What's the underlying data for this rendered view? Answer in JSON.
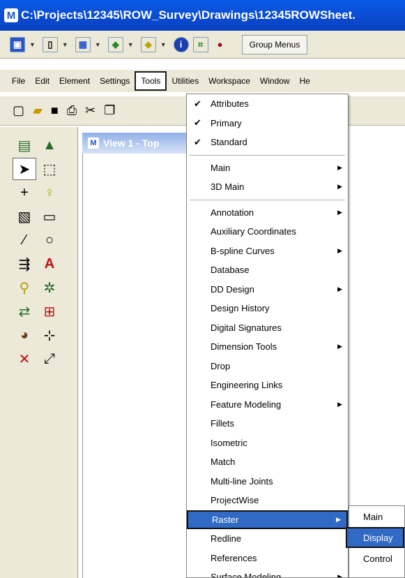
{
  "window": {
    "title": "C:\\Projects\\12345\\ROW_Survey\\Drawings\\12345ROWSheet."
  },
  "toolbar1": {
    "group_menus_label": "Group Menus"
  },
  "menubar": {
    "items": [
      {
        "label": "File"
      },
      {
        "label": "Edit"
      },
      {
        "label": "Element"
      },
      {
        "label": "Settings"
      },
      {
        "label": "Tools"
      },
      {
        "label": "Utilities"
      },
      {
        "label": "Workspace"
      },
      {
        "label": "Window"
      },
      {
        "label": "He"
      }
    ]
  },
  "view": {
    "title": "View 1 - Top"
  },
  "tools_menu": {
    "checked": [
      {
        "label": "Attributes"
      },
      {
        "label": "Primary"
      },
      {
        "label": "Standard"
      }
    ],
    "group2": [
      {
        "label": "Main"
      },
      {
        "label": "3D Main"
      }
    ],
    "group3": [
      {
        "label": "Annotation"
      },
      {
        "label": "Auxiliary Coordinates"
      },
      {
        "label": "B-spline Curves"
      },
      {
        "label": "Database"
      },
      {
        "label": "DD Design"
      },
      {
        "label": "Design History"
      },
      {
        "label": "Digital Signatures"
      },
      {
        "label": "Dimension Tools"
      },
      {
        "label": "Drop"
      },
      {
        "label": "Engineering Links"
      },
      {
        "label": "Feature Modeling"
      },
      {
        "label": "Fillets"
      },
      {
        "label": "Isometric"
      },
      {
        "label": "Match"
      },
      {
        "label": "Multi-line Joints"
      },
      {
        "label": "ProjectWise"
      },
      {
        "label": "Raster"
      },
      {
        "label": "Redline"
      },
      {
        "label": "References"
      },
      {
        "label": "Surface Modeling"
      }
    ]
  },
  "raster_submenu": {
    "items": [
      {
        "label": "Main"
      },
      {
        "label": "Display"
      },
      {
        "label": "Control"
      }
    ]
  },
  "colors": {
    "title_bar": "#0a4fd6",
    "highlight": "#316ac5",
    "chrome": "#ece9d8"
  }
}
